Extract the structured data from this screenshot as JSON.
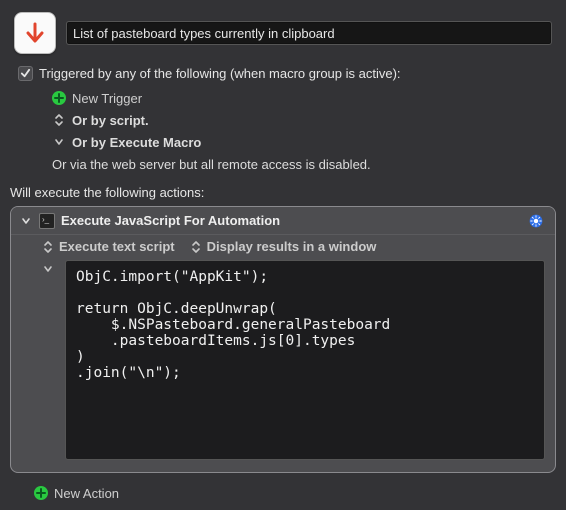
{
  "header": {
    "title_value": "List of pasteboard types currently in clipboard"
  },
  "triggers": {
    "checkbox_checked": true,
    "heading": "Triggered by any of the following (when macro group is active):",
    "new_trigger_label": "New Trigger",
    "or_by_script": "Or by script.",
    "or_by_execute_macro": "Or by Execute Macro",
    "or_via_web": "Or via the web server but all remote access is disabled."
  },
  "actions": {
    "heading": "Will execute the following actions:",
    "card": {
      "title": "Execute JavaScript For Automation",
      "sub_execute": "Execute text script",
      "sub_display": "Display results in a window",
      "code": "ObjC.import(\"AppKit\");\n\nreturn ObjC.deepUnwrap(\n    $.NSPasteboard.generalPasteboard\n    .pasteboardItems.js[0].types\n)\n.join(\"\\n\");"
    },
    "new_action_label": "New Action"
  },
  "icons": {
    "app_arrow": "down-arrow-icon",
    "plus": "plus-circle-icon",
    "updown": "expand-updown-icon",
    "chev_down": "chevron-down-icon",
    "gear": "gear-icon",
    "terminal": "terminal-icon"
  }
}
